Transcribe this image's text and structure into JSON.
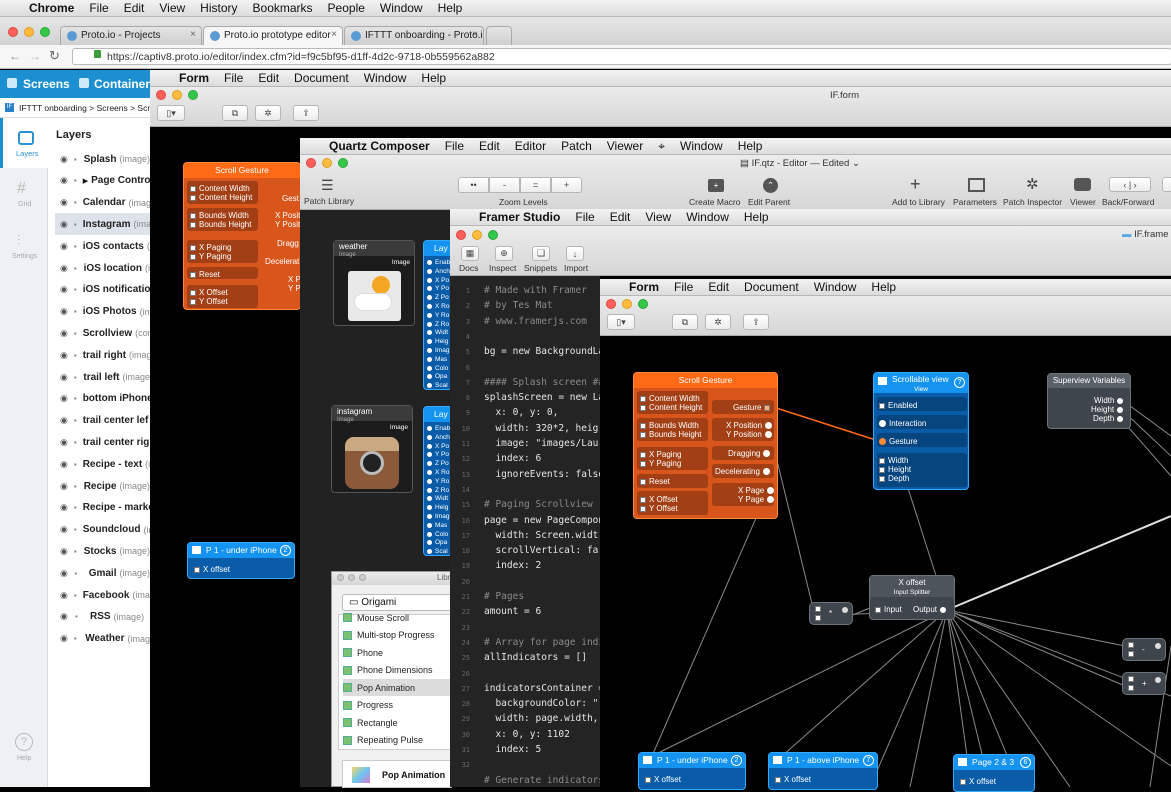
{
  "chrome": {
    "menu": [
      "Chrome",
      "File",
      "Edit",
      "View",
      "History",
      "Bookmarks",
      "People",
      "Window",
      "Help"
    ],
    "tabs": [
      {
        "label": "Proto.io - Projects"
      },
      {
        "label": "Proto.io prototype editor"
      },
      {
        "label": "IFTTT onboarding - Proto.i"
      }
    ],
    "url": "https://captiv8.proto.io/editor/index.cfm?id=f9c5bf95-d1ff-4d2c-9718-0b559562a882"
  },
  "protoio": {
    "screens_label": "Screens",
    "containers_label": "Containers",
    "breadcrumb": "IFTTT onboarding > Screens > Scre",
    "layers_title": "Layers",
    "side_tabs": [
      "Layers",
      "Grid",
      "Settings",
      "Help"
    ],
    "layers": [
      {
        "name": "Splash",
        "type": "(image)"
      },
      {
        "name": "Page Contro",
        "type": ""
      },
      {
        "name": "Calendar",
        "type": "(image)"
      },
      {
        "name": "Instagram",
        "type": "(image)"
      },
      {
        "name": "iOS contacts",
        "type": "(i"
      },
      {
        "name": "iOS location",
        "type": "(i"
      },
      {
        "name": "iOS notificatio",
        "type": ""
      },
      {
        "name": "iOS Photos",
        "type": "(ima"
      },
      {
        "name": "Scrollview",
        "type": "(con"
      },
      {
        "name": "trail right",
        "type": "(image"
      },
      {
        "name": "trail left",
        "type": "(image"
      },
      {
        "name": "bottom iPhone",
        "type": ""
      },
      {
        "name": "trail center lef",
        "type": ""
      },
      {
        "name": "trail center rig",
        "type": ""
      },
      {
        "name": "Recipe - text",
        "type": "(i"
      },
      {
        "name": "Recipe",
        "type": "(image)"
      },
      {
        "name": "Recipe - marke",
        "type": ""
      },
      {
        "name": "Soundcloud",
        "type": "(ir"
      },
      {
        "name": "Stocks",
        "type": "(image)"
      },
      {
        "name": "Gmail",
        "type": "(image)"
      },
      {
        "name": "Facebook",
        "type": "(imag"
      },
      {
        "name": "RSS",
        "type": "(image)"
      },
      {
        "name": "Weather",
        "type": "(imag"
      }
    ]
  },
  "form_back": {
    "menu": [
      "Form",
      "File",
      "Edit",
      "Document",
      "Window",
      "Help"
    ],
    "title": "IF.form"
  },
  "qc": {
    "menu": [
      "Quartz Composer",
      "File",
      "Edit",
      "Editor",
      "Patch",
      "Viewer",
      "Window",
      "Help"
    ],
    "title": "IF.qtz - Editor",
    "edited": "Edited",
    "toolbar": {
      "patch_library": "Patch Library",
      "zoom_levels": "Zoom Levels",
      "zoom_buttons": [
        "••",
        "-",
        "=",
        "+"
      ],
      "create_macro": "Create Macro",
      "edit_parent": "Edit Parent",
      "add_to_library": "Add to Library",
      "parameters": "Parameters",
      "patch_inspector": "Patch Inspector",
      "viewer": "Viewer",
      "back_forward": "Back/Forward"
    },
    "scroll_gesture": {
      "title": "Scroll Gesture",
      "inputs": [
        "Content Width",
        "Content Height",
        "Bounds Width",
        "Bounds Height",
        "X Paging",
        "Y Paging",
        "Reset",
        "X Offset",
        "Y Offset"
      ],
      "outputs": [
        "Gest",
        "X Posit",
        "Y Posit",
        "Dragg",
        "Decelerat",
        "X P",
        "Y P"
      ]
    },
    "weather": {
      "title": "weather",
      "sub": "Image",
      "port": "Image"
    },
    "instagram": {
      "title": "instagram",
      "sub": "Image",
      "port": "Image"
    },
    "layer_ports": [
      "Enab",
      "Anch",
      "X Po",
      "Y Po",
      "Z Po",
      "X Ro",
      "Y Ro",
      "Z Ro",
      "Widt",
      "Heig",
      "Imag",
      "Mas",
      "Colo",
      "Opa",
      "Scal"
    ],
    "layer_title": "Lay",
    "p1": {
      "title": "P 1 - under iPhone",
      "badge": "2",
      "port": "X offset"
    },
    "library": {
      "title": "Libr",
      "search": "Origami",
      "items": [
        "Mouse Scroll",
        "Multi-stop Progress",
        "Phone",
        "Phone Dimensions",
        "Pop Animation",
        "Progress",
        "Rectangle",
        "Repeating Pulse"
      ],
      "selected": "Pop Animation"
    }
  },
  "framer": {
    "menu": [
      "Framer Studio",
      "File",
      "Edit",
      "View",
      "Window",
      "Help"
    ],
    "folder": "IF.frame",
    "toolbar": [
      "Docs",
      "Inspect",
      "Snippets",
      "Import"
    ],
    "line_numbers": [
      "1",
      "2",
      "3",
      "4",
      "5",
      "6",
      "7",
      "8",
      "9",
      "10",
      "11",
      "12",
      "13",
      "14",
      "15",
      "16",
      "17",
      "18",
      "19",
      "20",
      "21",
      "22",
      "23",
      "24",
      "25",
      "26",
      "27",
      "28",
      "29",
      "30",
      "31",
      "32"
    ],
    "lines": [
      "# Made with Framer",
      "# by Tes Mat",
      "# www.framerjs.com",
      "",
      "bg = new BackgroundLay",
      "",
      "#### Splash screen ###",
      "splashScreen = new Lay",
      "  x: 0, y: 0,",
      "  width: 320*2, heig",
      "  image: \"images/Lau",
      "  index: 6",
      "  ignoreEvents: false",
      "",
      "# Paging Scrollview",
      "page = new PageCompone",
      "  width: Screen.widt",
      "  scrollVertical: fa",
      "  index: 2",
      "",
      "# Pages",
      "amount = 6",
      "",
      "# Array for page indic",
      "allIndicators = []",
      "",
      "indicatorsContainer =",
      "  backgroundColor: \"",
      "  width: page.width,",
      "  x: 0, y: 1102",
      "  index: 5",
      "",
      "# Generate indicators"
    ]
  },
  "form_front": {
    "menu": [
      "Form",
      "File",
      "Edit",
      "Document",
      "Window",
      "Help"
    ],
    "scroll_gesture": {
      "title": "Scroll Gesture",
      "inputs": [
        "Content Width",
        "Content Height",
        "Bounds Width",
        "Bounds Height",
        "X Paging",
        "Y Paging",
        "Reset",
        "X Offset",
        "Y Offset"
      ],
      "outputs": [
        "Gesture",
        "X Position",
        "Y Position",
        "Dragging",
        "Decelerating",
        "X Page",
        "Y Page"
      ]
    },
    "scrollable": {
      "title": "Scrollable view",
      "sub": "View",
      "badge": "?",
      "ports": [
        "Enabled",
        "Interaction",
        "Gesture",
        "Width",
        "Height",
        "Depth"
      ]
    },
    "superview": {
      "title": "Superview Variables",
      "ports": [
        "Width",
        "Height",
        "Depth"
      ]
    },
    "xoffset": {
      "title": "X offset",
      "sub": "Input Splitter",
      "input": "Input",
      "output": "Output"
    },
    "bottom_nodes": [
      {
        "title": "P 1 - under iPhone",
        "badge": "2",
        "port": "X offset"
      },
      {
        "title": "P 1 - above iPhone",
        "badge": "7",
        "port": "X offset"
      },
      {
        "title": "Page 2 & 3",
        "badge": "6",
        "port": "X offset"
      }
    ],
    "math": [
      "*",
      "-",
      "+"
    ]
  },
  "colors": {
    "orange": "#ff6a16",
    "blue": "#1493f0",
    "accent": "#2aa6e0"
  }
}
